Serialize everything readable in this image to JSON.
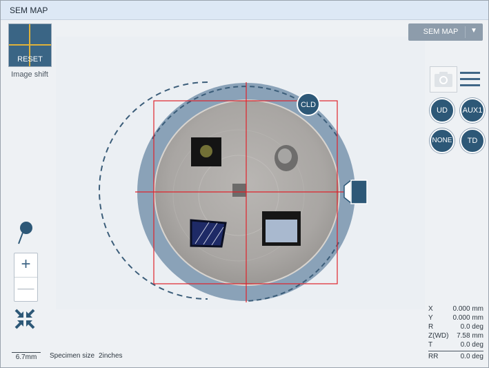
{
  "window": {
    "title": "SEM MAP"
  },
  "image_shift": {
    "reset_label": "RESET",
    "caption": "Image shift"
  },
  "mode_select": {
    "selected": "SEM MAP",
    "caret": "▼"
  },
  "toolbar": {
    "camera_icon": "camera-icon",
    "menu_icon": "hamburger-menu-icon"
  },
  "detectors": {
    "ud": "UD",
    "aux1": "AUX1",
    "none": "NONE",
    "td": "TD",
    "cld": "CLD"
  },
  "zoom": {
    "in_label": "+",
    "out_label": "—"
  },
  "icons": {
    "pin": "map-pin-icon",
    "fit": "collapse-arrows-icon"
  },
  "scale": {
    "label": "6.7mm"
  },
  "specimen": {
    "label": "Specimen size",
    "value": "2inches"
  },
  "coordinates": {
    "x": {
      "label": "X",
      "value": "0.000 mm"
    },
    "y": {
      "label": "Y",
      "value": "0.000 mm"
    },
    "r": {
      "label": "R",
      "value": "0.0 deg"
    },
    "z": {
      "label": "Z(WD)",
      "value": "7.58 mm"
    },
    "t": {
      "label": "T",
      "value": "0.0 deg"
    },
    "rr": {
      "label": "RR",
      "value": "0.0 deg"
    }
  },
  "colors": {
    "accent": "#2d5877",
    "stage": "#8aa2b8",
    "crosshair": "#e0222a",
    "shift_cross": "#e0b23a",
    "title_bar": "#dde8f5"
  }
}
